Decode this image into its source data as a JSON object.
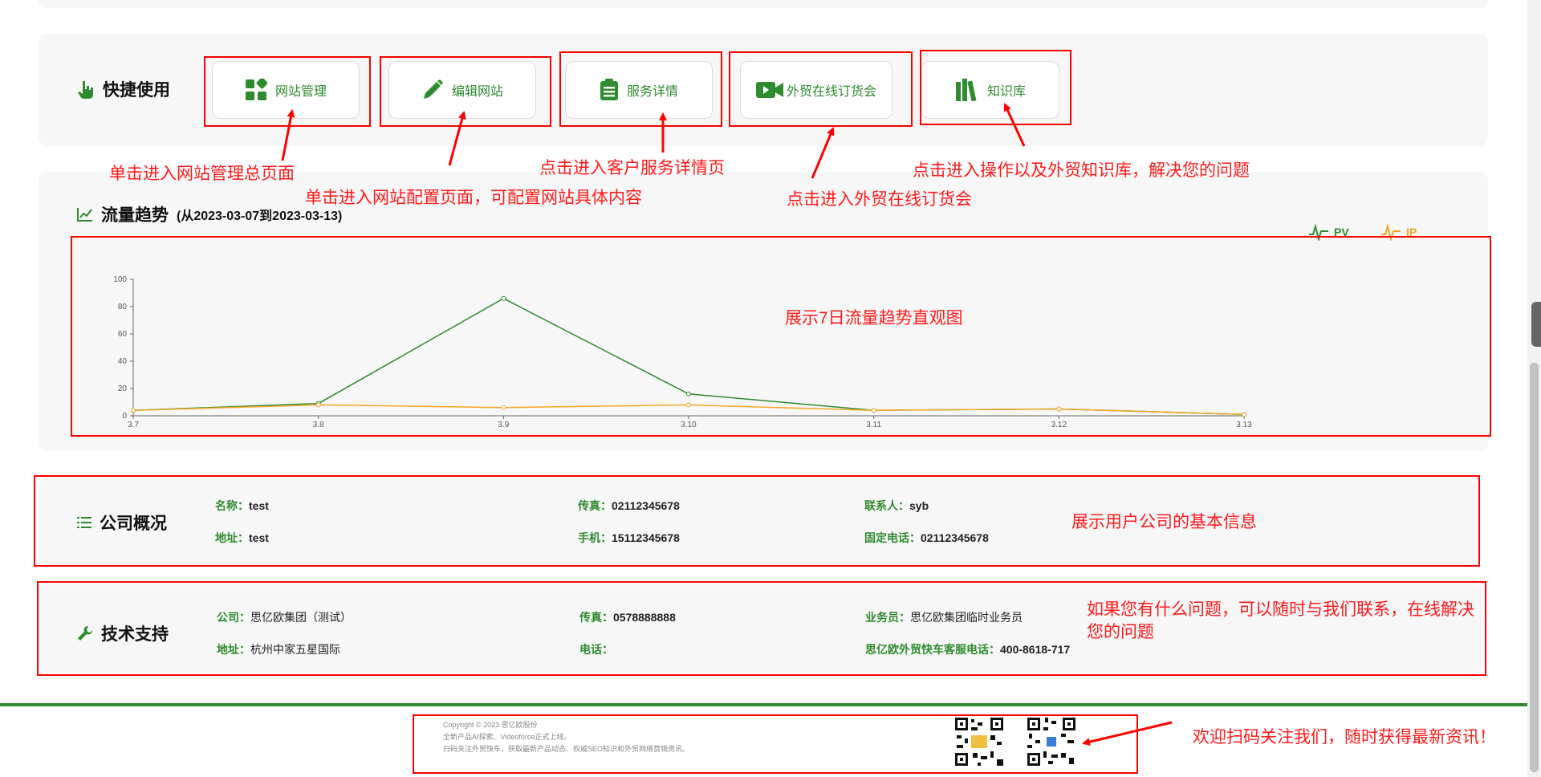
{
  "quick": {
    "title": "快捷使用",
    "buttons": [
      {
        "label": "网站管理",
        "icon": "grid-icon"
      },
      {
        "label": "编辑网站",
        "icon": "pencil-icon"
      },
      {
        "label": "服务详情",
        "icon": "clipboard-icon"
      },
      {
        "label": "外贸在线订货会",
        "icon": "video-icon"
      },
      {
        "label": "知识库",
        "icon": "books-icon"
      }
    ]
  },
  "annotations": {
    "a1": "单击进入网站管理总页面",
    "a2": "单击进入网站配置页面，可配置网站具体内容",
    "a3": "点击进入客户服务详情页",
    "a4": "点击进入外贸在线订货会",
    "a5": "点击进入操作以及外贸知识库，解决您的问题",
    "a6": "展示7日流量趋势直观图",
    "a7": "展示用户公司的基本信息",
    "a8_l1": "如果您有什么问题，可以随时与我们联系，在线解决",
    "a8_l2": "您的问题",
    "a9": "欢迎扫码关注我们，随时获得最新资讯！"
  },
  "traffic": {
    "title": "流量趋势",
    "range": "(从2023-03-07到2023-03-13)",
    "legend": {
      "pv": "PV",
      "ip": "IP"
    }
  },
  "chart_data": {
    "type": "line",
    "x": [
      "3.7",
      "3.8",
      "3.9",
      "3.10",
      "3.11",
      "3.12",
      "3.13"
    ],
    "series": [
      {
        "name": "PV",
        "color": "#2e8b2e",
        "values": [
          4,
          9,
          86,
          16,
          4,
          5,
          1
        ]
      },
      {
        "name": "IP",
        "color": "#f5a623",
        "values": [
          4,
          8,
          6,
          8,
          4,
          5,
          1
        ]
      }
    ],
    "ylim": [
      0,
      100
    ],
    "yticks": [
      0,
      20,
      40,
      60,
      80,
      100
    ]
  },
  "company": {
    "title": "公司概况",
    "name_k": "名称：",
    "name_v": "test",
    "addr_k": "地址：",
    "addr_v": "test",
    "fax_k": "传真：",
    "fax_v": "02112345678",
    "mobile_k": "手机：",
    "mobile_v": "15112345678",
    "contact_k": "联系人：",
    "contact_v": "syb",
    "tel_k": "固定电话：",
    "tel_v": "02112345678"
  },
  "support": {
    "title": "技术支持",
    "company_k": "公司：",
    "company_v": "思亿欧集团（测试）",
    "addr_k": "地址：",
    "addr_v": "杭州中家五星国际",
    "fax_k": "传真：",
    "fax_v": "0578888888",
    "phone_k": "电话：",
    "phone_v": "",
    "sales_k": "业务员：",
    "sales_v": "思亿欧集团临时业务员",
    "hotline_k": "思亿欧外贸快车客服电话：",
    "hotline_v": "400-8618-717"
  },
  "footer": {
    "l1": "Copyright © 2023 思亿欧股份",
    "l2": "全新产品AI探索、Videoforce正式上线。",
    "l3": "扫码关注外贸快车，获取最新产品动态、权威SEO知识和外贸网络营销资讯。"
  },
  "colors": {
    "accent": "#2e8b2e",
    "annotation": "#ff0000",
    "ip": "#f5a623"
  }
}
